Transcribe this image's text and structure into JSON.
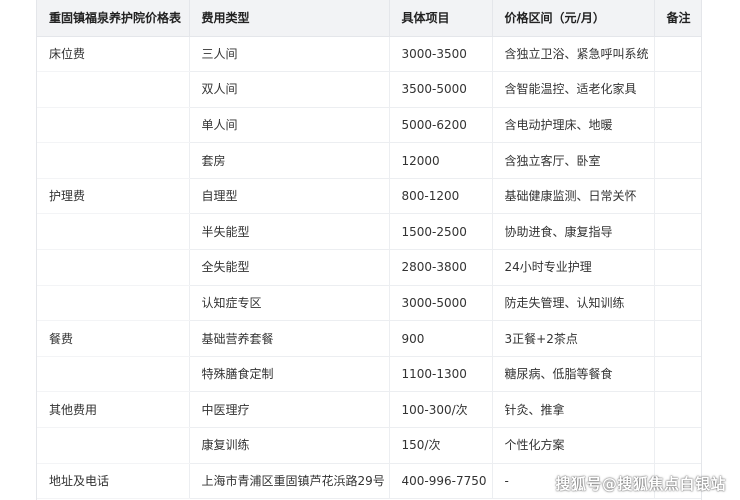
{
  "table": {
    "headers": [
      "重固镇福泉养护院价格表",
      "费用类型",
      "具体项目",
      "价格区间（元/月）",
      "备注"
    ],
    "rows": [
      [
        "床位费",
        "三人间",
        "3000-3500",
        "含独立卫浴、紧急呼叫系统",
        ""
      ],
      [
        "",
        "双人间",
        "3500-5000",
        "含智能温控、适老化家具",
        ""
      ],
      [
        "",
        "单人间",
        "5000-6200",
        "含电动护理床、地暖",
        ""
      ],
      [
        "",
        "套房",
        "12000",
        "含独立客厅、卧室",
        ""
      ],
      [
        "护理费",
        "自理型",
        "800-1200",
        "基础健康监测、日常关怀",
        ""
      ],
      [
        "",
        "半失能型",
        "1500-2500",
        "协助进食、康复指导",
        ""
      ],
      [
        "",
        "全失能型",
        "2800-3800",
        "24小时专业护理",
        ""
      ],
      [
        "",
        "认知症专区",
        "3000-5000",
        "防走失管理、认知训练",
        ""
      ],
      [
        "餐费",
        "基础营养套餐",
        "900",
        "3正餐+2茶点",
        ""
      ],
      [
        "",
        "特殊膳食定制",
        "1100-1300",
        "糖尿病、低脂等餐食",
        ""
      ],
      [
        "其他费用",
        "中医理疗",
        "100-300/次",
        "针灸、推拿",
        ""
      ],
      [
        "",
        "康复训练",
        "150/次",
        "个性化方案",
        ""
      ],
      [
        "地址及电话",
        "上海市青浦区重固镇芦花浜路29号",
        "400-996-7750",
        "-",
        ""
      ]
    ]
  },
  "watermark": "搜狐号@搜狐焦点白银站",
  "colors": {
    "header_bg": "#f2f3f5",
    "border": "#e4e6ea"
  }
}
